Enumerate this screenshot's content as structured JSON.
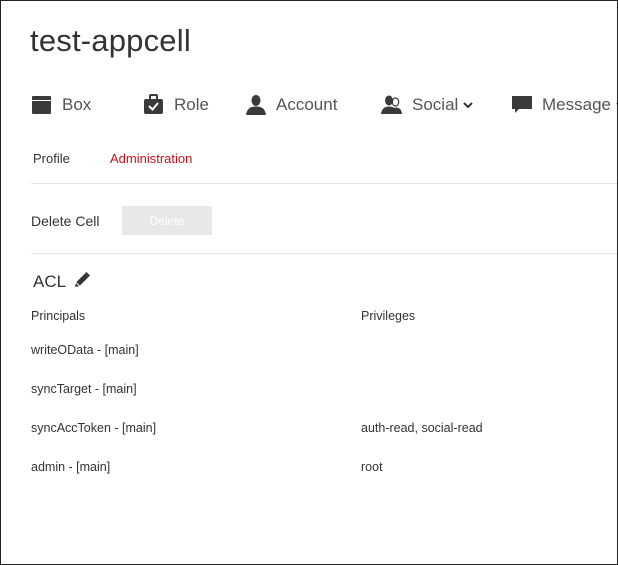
{
  "cell": {
    "title": "test-appcell"
  },
  "nav": {
    "items": [
      {
        "label": "Box",
        "icon": "box-icon"
      },
      {
        "label": "Role",
        "icon": "role-icon"
      },
      {
        "label": "Account",
        "icon": "account-icon"
      },
      {
        "label": "Social",
        "icon": "social-icon",
        "dropdown": true
      },
      {
        "label": "Message",
        "icon": "message-icon",
        "dropdown": true
      }
    ]
  },
  "subnav": {
    "tabs": [
      {
        "label": "Profile",
        "active": false
      },
      {
        "label": "Administration",
        "active": true
      }
    ],
    "active_color": "#c0141b"
  },
  "admin": {
    "delete_cell_label": "Delete Cell",
    "delete_button_label": "Delete"
  },
  "acl": {
    "title": "ACL",
    "columns": {
      "principals": "Principals",
      "privileges": "Privileges"
    },
    "rows": [
      {
        "principal": "writeOData - [main]",
        "privileges": ""
      },
      {
        "principal": "syncTarget - [main]",
        "privileges": ""
      },
      {
        "principal": "syncAccToken - [main]",
        "privileges": "auth-read, social-read"
      },
      {
        "principal": "admin - [main]",
        "privileges": "root"
      }
    ]
  }
}
